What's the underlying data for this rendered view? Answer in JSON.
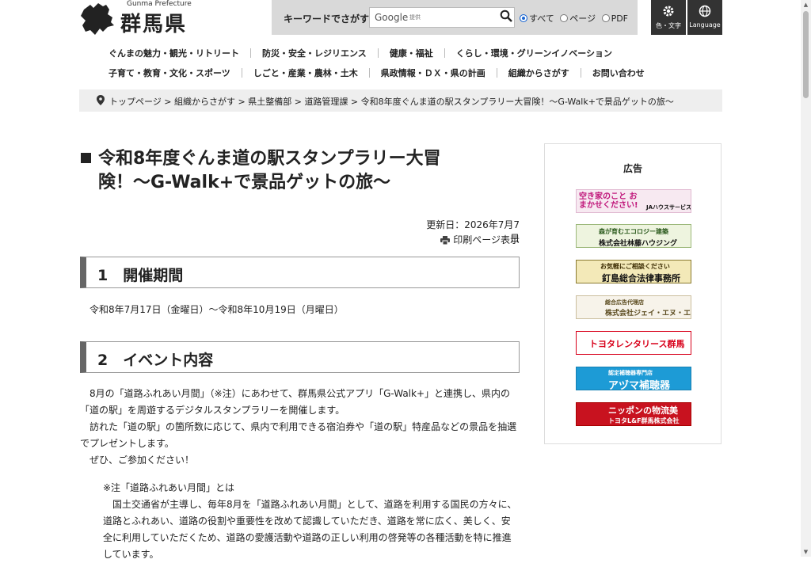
{
  "header": {
    "logo_en": "Gunma Prefecture",
    "logo_ja": "群馬県",
    "search_label": "キーワードでさがす",
    "search_provider": "Google",
    "search_provider_note": "提供",
    "search_options": [
      "すべて",
      "ページ",
      "PDF"
    ],
    "search_selected": "すべて",
    "color_text_button": "色・文字",
    "language_button": "Language"
  },
  "nav": {
    "row1": [
      "ぐんまの魅力・観光・リトリート",
      "防災・安全・レジリエンス",
      "健康・福祉",
      "くらし・環境・グリーンイノベーション"
    ],
    "row2": [
      "子育て・教育・文化・スポーツ",
      "しごと・産業・農林・土木",
      "県政情報・ＤＸ・県の計画",
      "組織からさがす",
      "お問い合わせ"
    ]
  },
  "breadcrumb": [
    "トップページ",
    "組織からさがす",
    "県土整備部",
    "道路管理課",
    "令和8年度ぐんま道の駅スタンプラリー大冒険！～G-Walk+で景品ゲットの旅～"
  ],
  "page": {
    "title_line1": "令和8年度ぐんま道の駅スタンプラリー大冒",
    "title_line2": "険！～G-Walk+で景品ゲットの旅～",
    "updated": "更新日：2026年7月7日",
    "print": "印刷ページ表示"
  },
  "sections": [
    {
      "heading": "1　開催期間",
      "paragraphs": [
        "令和8年7月17日（金曜日）～令和8年10月19日（月曜日）"
      ]
    },
    {
      "heading": "2　イベント内容",
      "paragraphs": [
        "8月の「道路ふれあい月間」（※注）にあわせて、群馬県公式アプリ「G-Walk+」と連携し、県内の",
        "「道の駅」を周遊するデジタルスタンプラリーを開催します。",
        "訪れた「道の駅」の箇所数に応じて、県内で利用できる宿泊券や「道の駅」特産品などの景品を抽選",
        "でプレゼントします。",
        "ぜひ、ご参加ください！"
      ],
      "note": [
        "※注「道路ふれあい月間」とは",
        "国土交通省が主導し、毎年8月を「道路ふれあい月間」として、道路を利用する国民の方々に、",
        "道路とふれあい、道路の役割や重要性を改めて認識していただき、道路を常に広く、美しく、安",
        "全に利用していただくため、道路の愛護活動や道路の正しい利用の啓発等の各種活動を特に推進",
        "しています。"
      ]
    }
  ],
  "ads": {
    "heading": "広告",
    "items": [
      {
        "name": "ad-ja-house-service",
        "text": "空き家のこと おまかせください!",
        "sub": "JAハウスサービス",
        "bg": "#f7e9f1",
        "fg": "#c0167a"
      },
      {
        "name": "ad-hayashifuji-housing",
        "text": "森が育むエコロジー建築",
        "sub": "株式会社林藤ハウジング",
        "bg": "#eef4df",
        "fg": "#2b5a1d"
      },
      {
        "name": "ad-kugishima-law",
        "text": "お気軽にご相談ください",
        "sub": "釘島総合法律事務所",
        "bg": "#f3e9b8",
        "fg": "#3a2a00"
      },
      {
        "name": "ad-jei-enu-esu",
        "text": "総合広告代理店",
        "sub": "株式会社ジェイ・エヌ・エス",
        "bg": "#f7f3ea",
        "fg": "#5a4a1e"
      },
      {
        "name": "ad-toyota-rentalease",
        "text": "トヨタレンタリース群馬",
        "sub": "",
        "bg": "#ffffff",
        "fg": "#d8001a"
      },
      {
        "name": "ad-azuma-hearing",
        "text": "アヅマ補聴器",
        "sub": "認定補聴器専門店",
        "bg": "#1d9bd6",
        "fg": "#ffffff"
      },
      {
        "name": "ad-toyota-lf-gunma",
        "text": "ニッポンの物流美",
        "sub": "トヨタL&F群馬株式会社",
        "bg": "#c8121f",
        "fg": "#ffffff"
      }
    ]
  },
  "colors": {
    "accent_blue": "#1a66d2",
    "header_gray": "#d9d9d9",
    "dark_button": "#333333"
  }
}
